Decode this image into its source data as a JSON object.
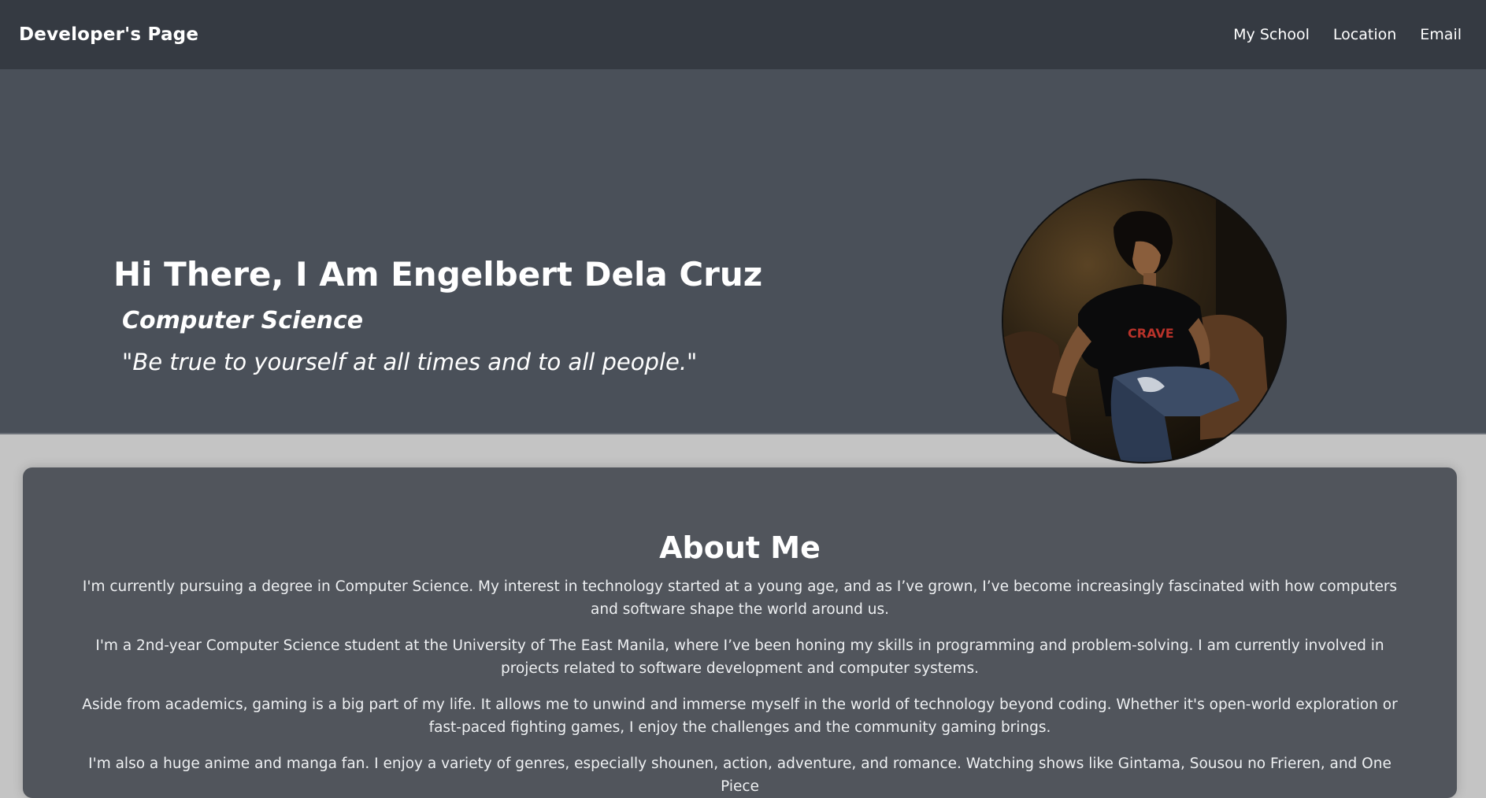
{
  "nav": {
    "brand": "Developer's Page",
    "links": [
      "My School",
      "Location",
      "Email"
    ]
  },
  "hero": {
    "title": "Hi There, I Am Engelbert Dela Cruz",
    "major": "Computer Science",
    "quote": "\"Be true to yourself at all times and to all people.\"",
    "shirt_text": "CRAVE"
  },
  "about": {
    "heading": "About Me",
    "paragraphs": [
      "I'm currently pursuing a degree in Computer Science. My interest in technology started at a young age, and as I’ve grown, I’ve become increasingly fascinated with how computers and software shape the world around us.",
      "I'm a 2nd-year Computer Science student at the University of The East Manila, where I’ve been honing my skills in programming and problem-solving. I am currently involved in projects related to software development and computer systems.",
      "Aside from academics, gaming is a big part of my life. It allows me to unwind and immerse myself in the world of technology beyond coding. Whether it's open-world exploration or fast-paced fighting games, I enjoy the challenges and the community gaming brings.",
      "I'm also a huge anime and manga fan. I enjoy a variety of genres, especially shounen, action, adventure, and romance. Watching shows like Gintama, Sousou no Frieren, and One Piece"
    ]
  },
  "colors": {
    "navbar": "#353a42",
    "hero": "#4a5059",
    "page": "#c4c4c4",
    "card": "#51555c"
  }
}
